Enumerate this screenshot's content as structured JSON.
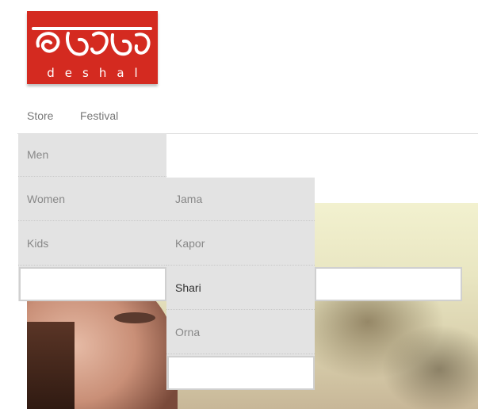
{
  "brand": {
    "logo_subtitle": "deshal",
    "logo_color": "#d42a20"
  },
  "nav": {
    "items": [
      {
        "label": "Store"
      },
      {
        "label": "Festival"
      }
    ]
  },
  "menu_primary": {
    "items": [
      {
        "label": "Men"
      },
      {
        "label": "Women"
      },
      {
        "label": "Kids"
      }
    ]
  },
  "menu_secondary": {
    "items": [
      {
        "label": "Jama"
      },
      {
        "label": "Kapor"
      },
      {
        "label": "Shari",
        "active": true
      },
      {
        "label": "Orna"
      }
    ]
  },
  "colors": {
    "menu_bg": "#e3e3e3",
    "menu_text": "#888888",
    "menu_active_text": "#333333"
  }
}
